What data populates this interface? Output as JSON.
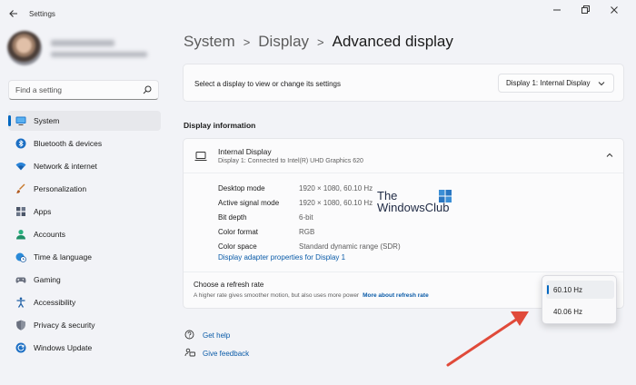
{
  "app": {
    "title": "Settings"
  },
  "search": {
    "placeholder": "Find a setting"
  },
  "sidebar": {
    "items": [
      {
        "label": "System",
        "icon": "monitor-icon",
        "active": true
      },
      {
        "label": "Bluetooth & devices",
        "icon": "bluetooth-icon"
      },
      {
        "label": "Network & internet",
        "icon": "wifi-icon"
      },
      {
        "label": "Personalization",
        "icon": "brush-icon"
      },
      {
        "label": "Apps",
        "icon": "apps-icon"
      },
      {
        "label": "Accounts",
        "icon": "person-icon"
      },
      {
        "label": "Time & language",
        "icon": "globe-clock-icon"
      },
      {
        "label": "Gaming",
        "icon": "gamepad-icon"
      },
      {
        "label": "Accessibility",
        "icon": "accessibility-icon"
      },
      {
        "label": "Privacy & security",
        "icon": "shield-icon"
      },
      {
        "label": "Windows Update",
        "icon": "update-icon"
      }
    ]
  },
  "breadcrumb": {
    "items": [
      "System",
      "Display"
    ],
    "current": "Advanced display"
  },
  "select_display": {
    "text": "Select a display to view or change its settings",
    "value": "Display 1: Internal Display"
  },
  "display_info": {
    "section_title": "Display information",
    "name": "Internal Display",
    "subtitle": "Display 1: Connected to Intel(R) UHD Graphics 620",
    "properties": [
      {
        "label": "Desktop mode",
        "value": "1920 × 1080, 60.10 Hz"
      },
      {
        "label": "Active signal mode",
        "value": "1920 × 1080, 60.10 Hz"
      },
      {
        "label": "Bit depth",
        "value": "6-bit"
      },
      {
        "label": "Color format",
        "value": "RGB"
      },
      {
        "label": "Color space",
        "value": "Standard dynamic range (SDR)"
      }
    ],
    "adapter_link": "Display adapter properties for Display 1"
  },
  "refresh_rate": {
    "title": "Choose a refresh rate",
    "description": "A higher rate gives smoother motion, but also uses more power",
    "link": "More about refresh rate",
    "options": [
      "60.10 Hz",
      "40.06 Hz"
    ],
    "selected": "60.10 Hz"
  },
  "watermark": {
    "line1": "The",
    "line2": "WindowsClub"
  },
  "help": {
    "get_help": "Get help",
    "give_feedback": "Give feedback"
  },
  "colors": {
    "accent": "#0067c0",
    "link": "#0a5ba8",
    "arrow": "#e04a3a",
    "background": "#f2f3f7"
  }
}
